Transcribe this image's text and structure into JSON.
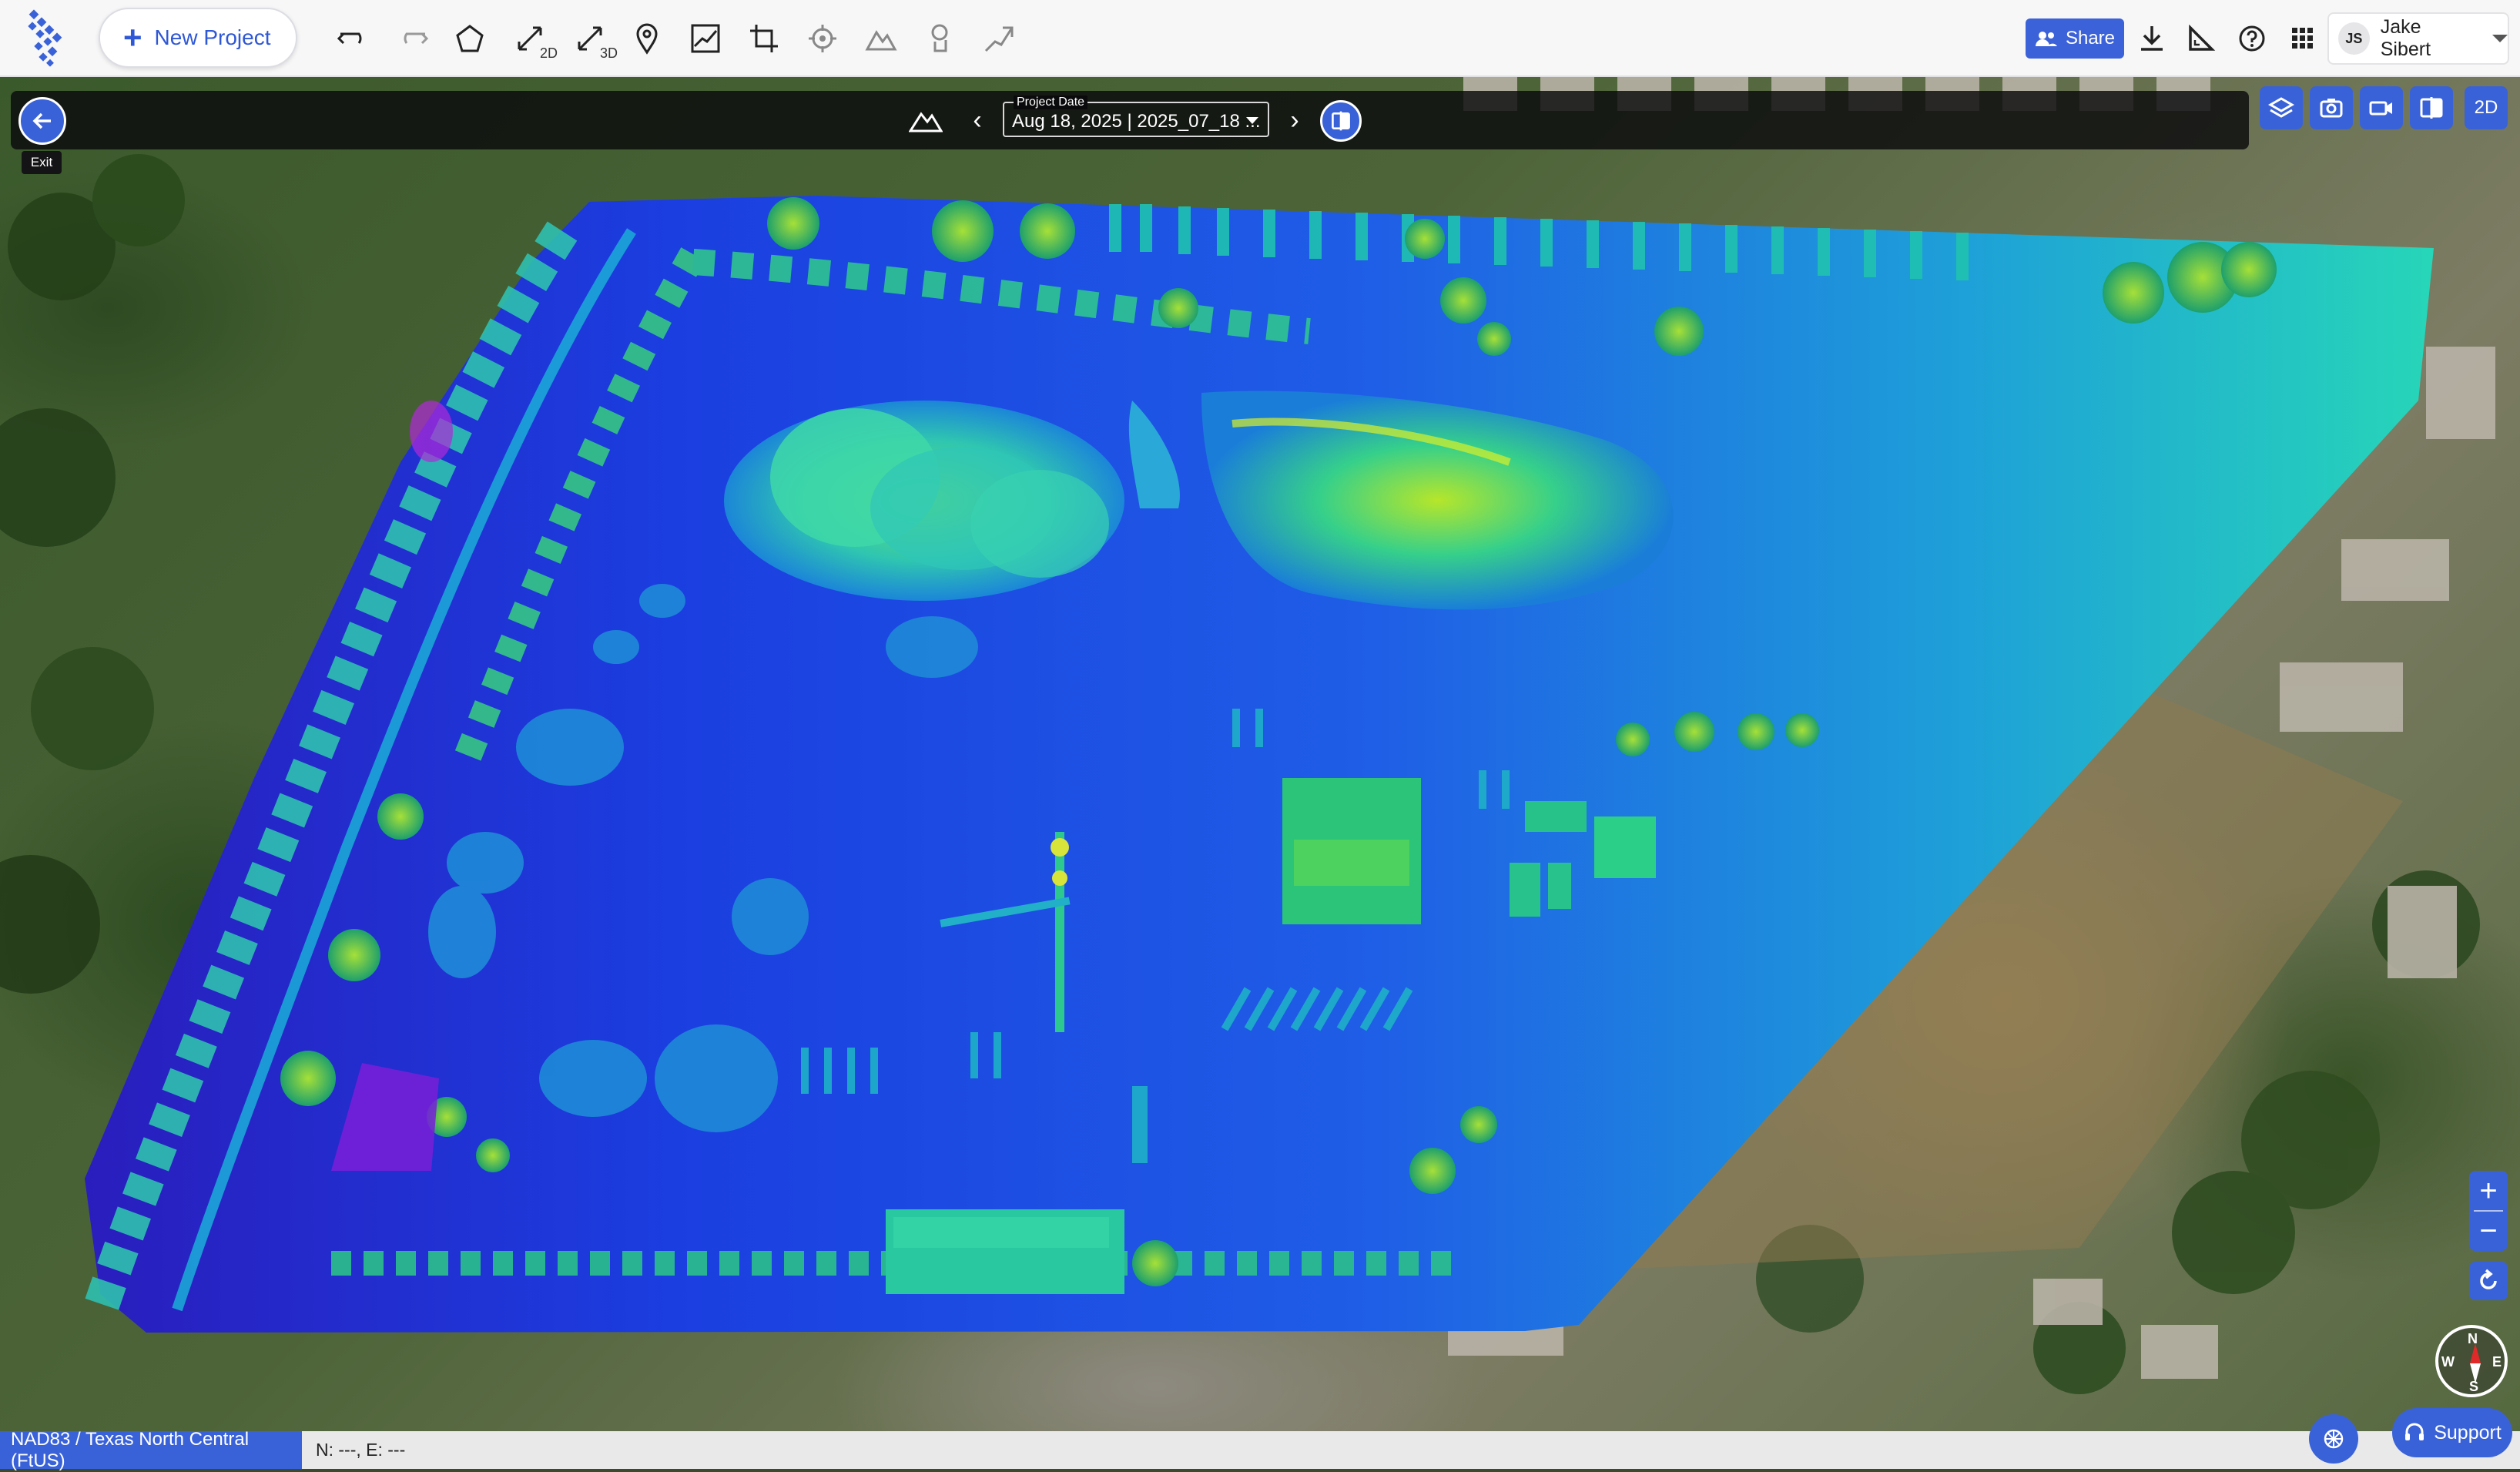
{
  "toolbar": {
    "new_project_label": "New Project",
    "tools": [
      {
        "icon": "undo-icon"
      },
      {
        "icon": "redo-icon"
      },
      {
        "icon": "polygon-icon"
      },
      {
        "icon": "measure-2d-icon",
        "sub": "2D"
      },
      {
        "icon": "measure-3d-icon",
        "sub": "3D"
      },
      {
        "icon": "location-pin-icon"
      },
      {
        "icon": "profile-icon"
      },
      {
        "icon": "crop-icon"
      },
      {
        "icon": "target-icon"
      },
      {
        "icon": "volume-icon"
      },
      {
        "icon": "hand-pointer-icon"
      },
      {
        "icon": "pen-tool-icon"
      }
    ],
    "share_label": "Share",
    "user": {
      "initials": "JS",
      "name": "Jake Sibert"
    }
  },
  "viewer": {
    "exit_label": "Exit",
    "project_date_caption": "Project Date",
    "project_date_value": "Aug 18, 2025 | 2025_07_18 ...",
    "view_mode": "2D"
  },
  "status": {
    "crs": "NAD83 / Texas North Central (FtUS)",
    "coords": "N: ---, E: ---"
  },
  "compass": {
    "n": "N",
    "e": "E",
    "s": "S",
    "w": "W"
  },
  "support_label": "Support",
  "colors": {
    "accent": "#3a62d8",
    "toolbar_bg": "#f7f7f8"
  }
}
